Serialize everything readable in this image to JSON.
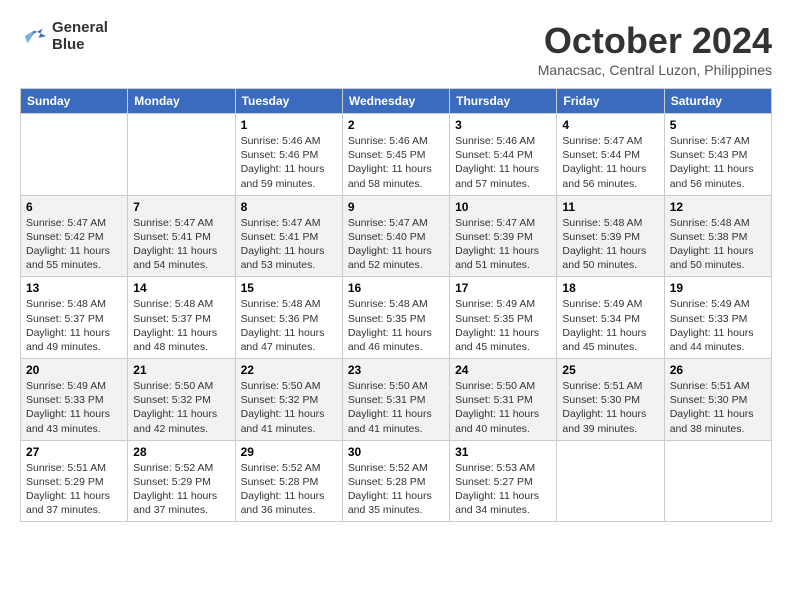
{
  "header": {
    "logo_line1": "General",
    "logo_line2": "Blue",
    "month": "October 2024",
    "location": "Manacsac, Central Luzon, Philippines"
  },
  "days_of_week": [
    "Sunday",
    "Monday",
    "Tuesday",
    "Wednesday",
    "Thursday",
    "Friday",
    "Saturday"
  ],
  "weeks": [
    [
      {
        "day": "",
        "info": ""
      },
      {
        "day": "",
        "info": ""
      },
      {
        "day": "1",
        "info": "Sunrise: 5:46 AM\nSunset: 5:46 PM\nDaylight: 11 hours and 59 minutes."
      },
      {
        "day": "2",
        "info": "Sunrise: 5:46 AM\nSunset: 5:45 PM\nDaylight: 11 hours and 58 minutes."
      },
      {
        "day": "3",
        "info": "Sunrise: 5:46 AM\nSunset: 5:44 PM\nDaylight: 11 hours and 57 minutes."
      },
      {
        "day": "4",
        "info": "Sunrise: 5:47 AM\nSunset: 5:44 PM\nDaylight: 11 hours and 56 minutes."
      },
      {
        "day": "5",
        "info": "Sunrise: 5:47 AM\nSunset: 5:43 PM\nDaylight: 11 hours and 56 minutes."
      }
    ],
    [
      {
        "day": "6",
        "info": "Sunrise: 5:47 AM\nSunset: 5:42 PM\nDaylight: 11 hours and 55 minutes."
      },
      {
        "day": "7",
        "info": "Sunrise: 5:47 AM\nSunset: 5:41 PM\nDaylight: 11 hours and 54 minutes."
      },
      {
        "day": "8",
        "info": "Sunrise: 5:47 AM\nSunset: 5:41 PM\nDaylight: 11 hours and 53 minutes."
      },
      {
        "day": "9",
        "info": "Sunrise: 5:47 AM\nSunset: 5:40 PM\nDaylight: 11 hours and 52 minutes."
      },
      {
        "day": "10",
        "info": "Sunrise: 5:47 AM\nSunset: 5:39 PM\nDaylight: 11 hours and 51 minutes."
      },
      {
        "day": "11",
        "info": "Sunrise: 5:48 AM\nSunset: 5:39 PM\nDaylight: 11 hours and 50 minutes."
      },
      {
        "day": "12",
        "info": "Sunrise: 5:48 AM\nSunset: 5:38 PM\nDaylight: 11 hours and 50 minutes."
      }
    ],
    [
      {
        "day": "13",
        "info": "Sunrise: 5:48 AM\nSunset: 5:37 PM\nDaylight: 11 hours and 49 minutes."
      },
      {
        "day": "14",
        "info": "Sunrise: 5:48 AM\nSunset: 5:37 PM\nDaylight: 11 hours and 48 minutes."
      },
      {
        "day": "15",
        "info": "Sunrise: 5:48 AM\nSunset: 5:36 PM\nDaylight: 11 hours and 47 minutes."
      },
      {
        "day": "16",
        "info": "Sunrise: 5:48 AM\nSunset: 5:35 PM\nDaylight: 11 hours and 46 minutes."
      },
      {
        "day": "17",
        "info": "Sunrise: 5:49 AM\nSunset: 5:35 PM\nDaylight: 11 hours and 45 minutes."
      },
      {
        "day": "18",
        "info": "Sunrise: 5:49 AM\nSunset: 5:34 PM\nDaylight: 11 hours and 45 minutes."
      },
      {
        "day": "19",
        "info": "Sunrise: 5:49 AM\nSunset: 5:33 PM\nDaylight: 11 hours and 44 minutes."
      }
    ],
    [
      {
        "day": "20",
        "info": "Sunrise: 5:49 AM\nSunset: 5:33 PM\nDaylight: 11 hours and 43 minutes."
      },
      {
        "day": "21",
        "info": "Sunrise: 5:50 AM\nSunset: 5:32 PM\nDaylight: 11 hours and 42 minutes."
      },
      {
        "day": "22",
        "info": "Sunrise: 5:50 AM\nSunset: 5:32 PM\nDaylight: 11 hours and 41 minutes."
      },
      {
        "day": "23",
        "info": "Sunrise: 5:50 AM\nSunset: 5:31 PM\nDaylight: 11 hours and 41 minutes."
      },
      {
        "day": "24",
        "info": "Sunrise: 5:50 AM\nSunset: 5:31 PM\nDaylight: 11 hours and 40 minutes."
      },
      {
        "day": "25",
        "info": "Sunrise: 5:51 AM\nSunset: 5:30 PM\nDaylight: 11 hours and 39 minutes."
      },
      {
        "day": "26",
        "info": "Sunrise: 5:51 AM\nSunset: 5:30 PM\nDaylight: 11 hours and 38 minutes."
      }
    ],
    [
      {
        "day": "27",
        "info": "Sunrise: 5:51 AM\nSunset: 5:29 PM\nDaylight: 11 hours and 37 minutes."
      },
      {
        "day": "28",
        "info": "Sunrise: 5:52 AM\nSunset: 5:29 PM\nDaylight: 11 hours and 37 minutes."
      },
      {
        "day": "29",
        "info": "Sunrise: 5:52 AM\nSunset: 5:28 PM\nDaylight: 11 hours and 36 minutes."
      },
      {
        "day": "30",
        "info": "Sunrise: 5:52 AM\nSunset: 5:28 PM\nDaylight: 11 hours and 35 minutes."
      },
      {
        "day": "31",
        "info": "Sunrise: 5:53 AM\nSunset: 5:27 PM\nDaylight: 11 hours and 34 minutes."
      },
      {
        "day": "",
        "info": ""
      },
      {
        "day": "",
        "info": ""
      }
    ]
  ]
}
